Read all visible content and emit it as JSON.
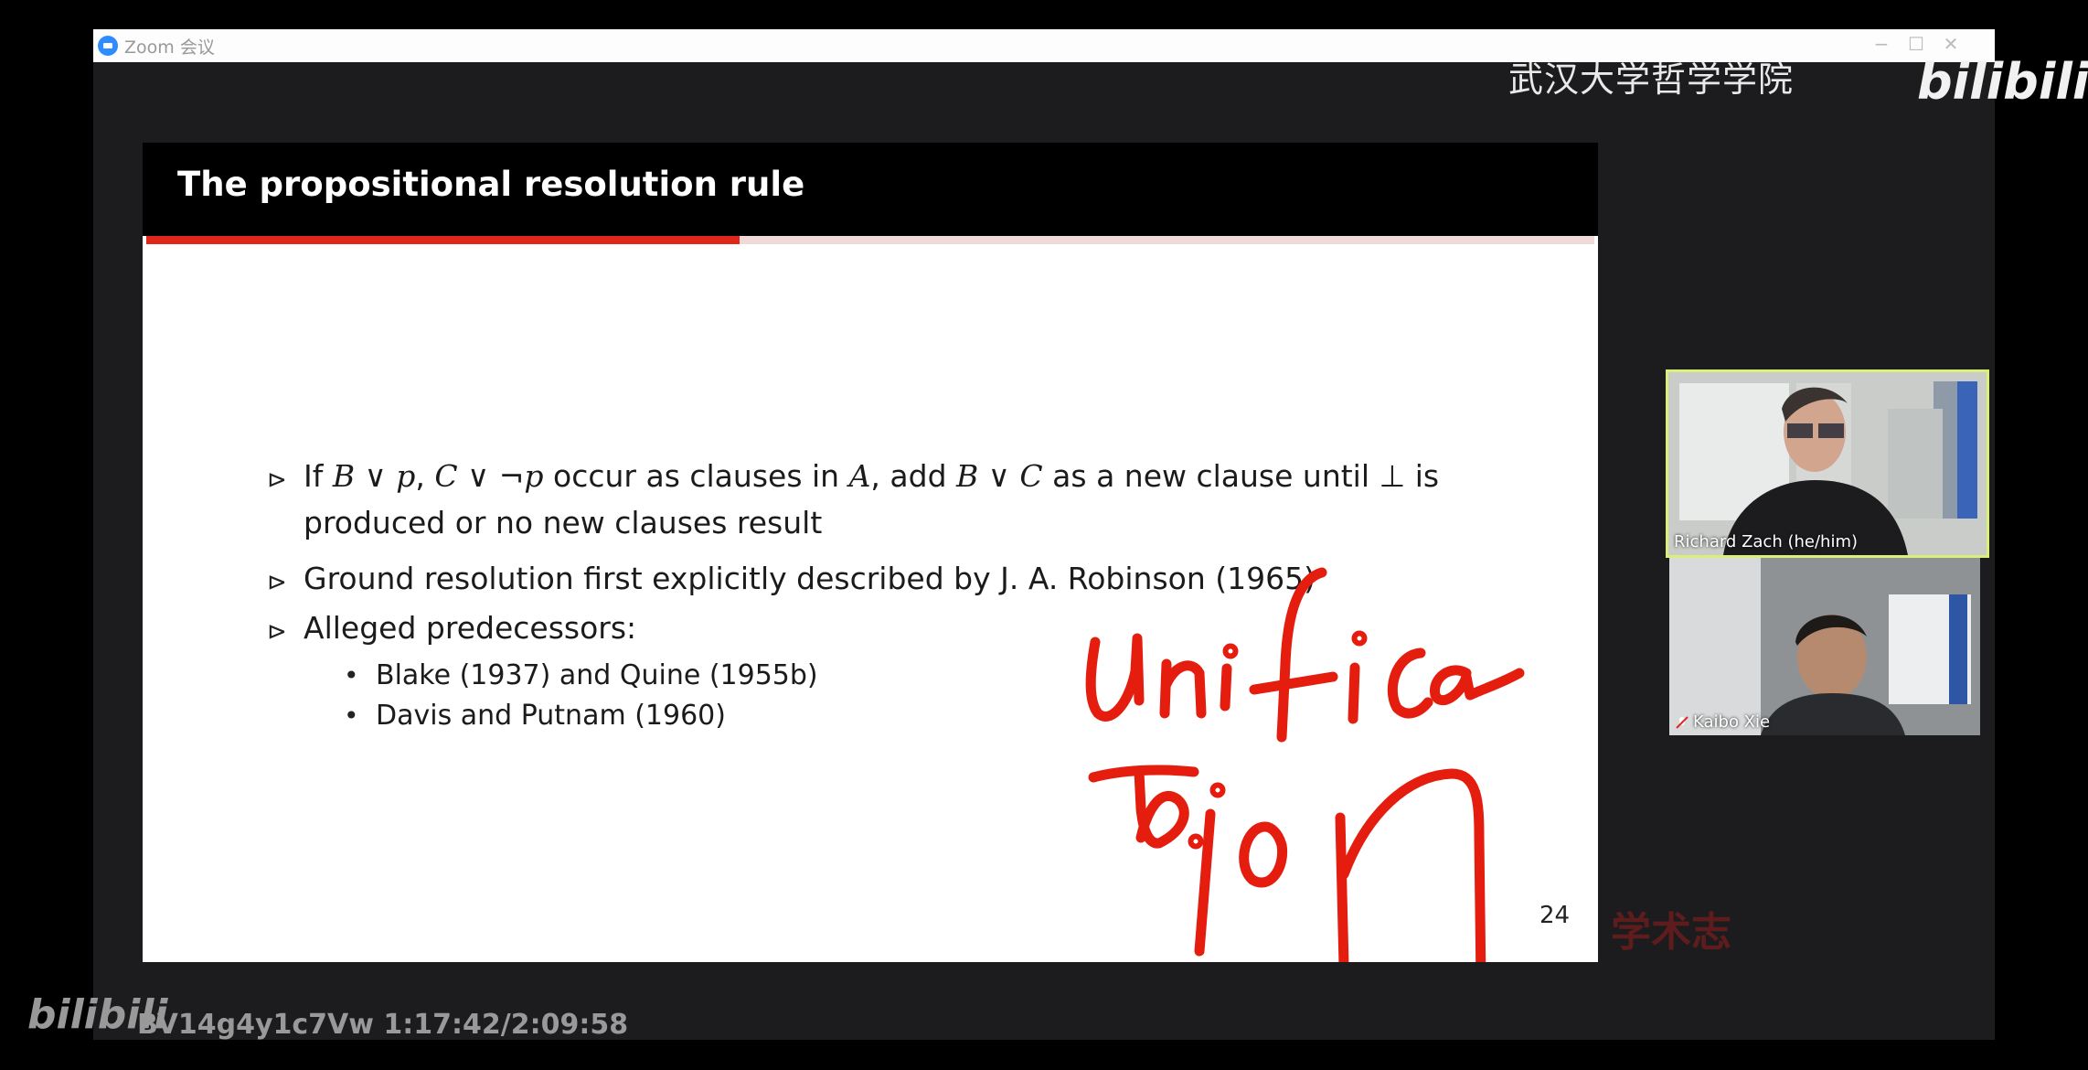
{
  "window": {
    "title": "Zoom 会议",
    "controls": {
      "minimize": "−",
      "maximize": "☐",
      "close": "✕"
    }
  },
  "watermarks": {
    "top_text": "武汉大学哲学学院",
    "top_logo": "bilibili",
    "bottom_logo": "bilibili",
    "bottom_text": "BV14g4y1c7Vw 1:17:42/2:09:58",
    "stamp": "学术志"
  },
  "slide": {
    "title": "The propositional resolution rule",
    "progress_fraction": 0.41,
    "page_number": "24",
    "bullet1": {
      "marker": "⊳",
      "p1": "If ",
      "m1": "B",
      "p2": " ∨ ",
      "m2": "p",
      "p3": ", ",
      "m3": "C",
      "p4": " ∨ ¬",
      "m4": "p",
      "p5": " occur as clauses in ",
      "m5": "A",
      "p6": ", add ",
      "m6": "B",
      "p7": " ∨ ",
      "m7": "C",
      "p8": " as a new clause until ⊥ is",
      "line2": "produced or no new clauses result"
    },
    "bullet2": {
      "marker": "⊳",
      "text": "Ground resolution first explicitly described by J. A. Robinson (1965)"
    },
    "bullet3": {
      "marker": "⊳",
      "text": "Alleged predecessors:",
      "sub": [
        {
          "marker": "•",
          "text": "Blake (1937) and Quine (1955b)"
        },
        {
          "marker": "•",
          "text": "Davis and Putnam (1960)"
        }
      ]
    },
    "annotation": {
      "color": "#e41d0f",
      "text": "unification"
    }
  },
  "participants": [
    {
      "name": "Richard Zach (he/him)",
      "active_speaker": true,
      "highlight": "#d8f07a"
    },
    {
      "name": "Kaibo Xie",
      "muted": true
    }
  ]
}
